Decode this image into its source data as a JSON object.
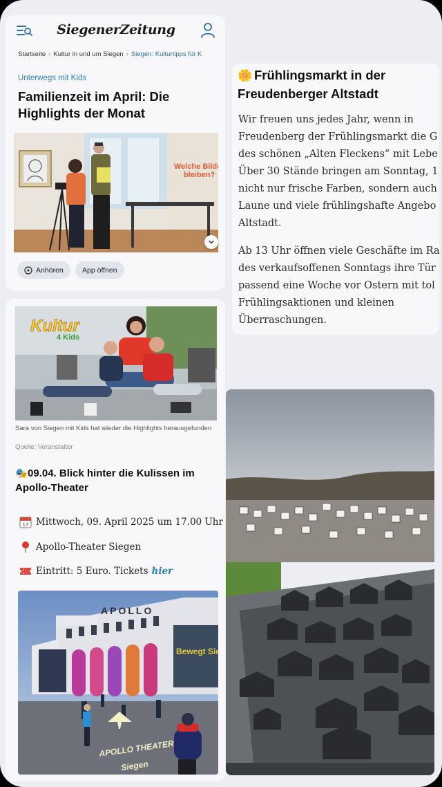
{
  "header": {
    "logo_text": "SiegenerZeitung",
    "menu_icon": "menu-search-icon",
    "user_icon": "user-icon"
  },
  "breadcrumb": {
    "items": [
      "Startseite",
      "Kultur in und um Siegen",
      "Siegen: Kulturtipps für K"
    ]
  },
  "article": {
    "kicker": "Unterwegs mit Kids",
    "headline": "Familienzeit im April: Die Highlights der Monat",
    "hero_sign_text": "Welche Bilder bleiben?",
    "expand_icon": "chevron-down-icon",
    "actions": {
      "listen_label": "Anhören",
      "app_label": "App öffnen"
    },
    "photo2_logo_line1": "Kultur",
    "photo2_logo_line2": "4 Kids",
    "caption": "Sara von Siegen mit Kids hat wieder die Highlights herausgefunden",
    "source": "Quelle: Veranstalter"
  },
  "event": {
    "title": "09.04. Blick hinter die Kulissen im Apollo-Theater",
    "date_text": "Mittwoch, 09. April 2025 um 17.00 Uhr",
    "location_text": "Apollo-Theater Siegen",
    "entry_text": "Eintritt: 5 Euro. Tickets",
    "ticket_link": "hier",
    "building_sign": "APOLLO",
    "poster_text": "Bewegt Siegen",
    "ground_text_line1": "APOLLO THEATER",
    "ground_text_line2": "Siegen"
  },
  "right_article": {
    "title": "Frühlingsmarkt in der Freudenberger Altstadt",
    "para1_lines": [
      "Wir freuen uns jedes Jahr, wenn in",
      "Freudenberg der Frühlingsmarkt die G",
      "des schönen „Alten Fleckens“ mit Lebe",
      "Über 30 Stände bringen am Sonntag, 1",
      "nicht nur frische Farben, sondern auch",
      "Laune und viele frühlingshafte Angebo",
      "Altstadt."
    ],
    "para2_lines": [
      "Ab 13 Uhr öffnen viele Geschäfte im Ra",
      "des verkaufsoffenen Sonntags ihre Tür",
      "passend eine Woche vor Ostern mit tol",
      "Frühlingsaktionen und kleinen",
      "Überraschungen."
    ]
  },
  "colors": {
    "accent_blue": "#2b7fbf",
    "background": "#eceef4",
    "card": "#f6f7fb"
  }
}
